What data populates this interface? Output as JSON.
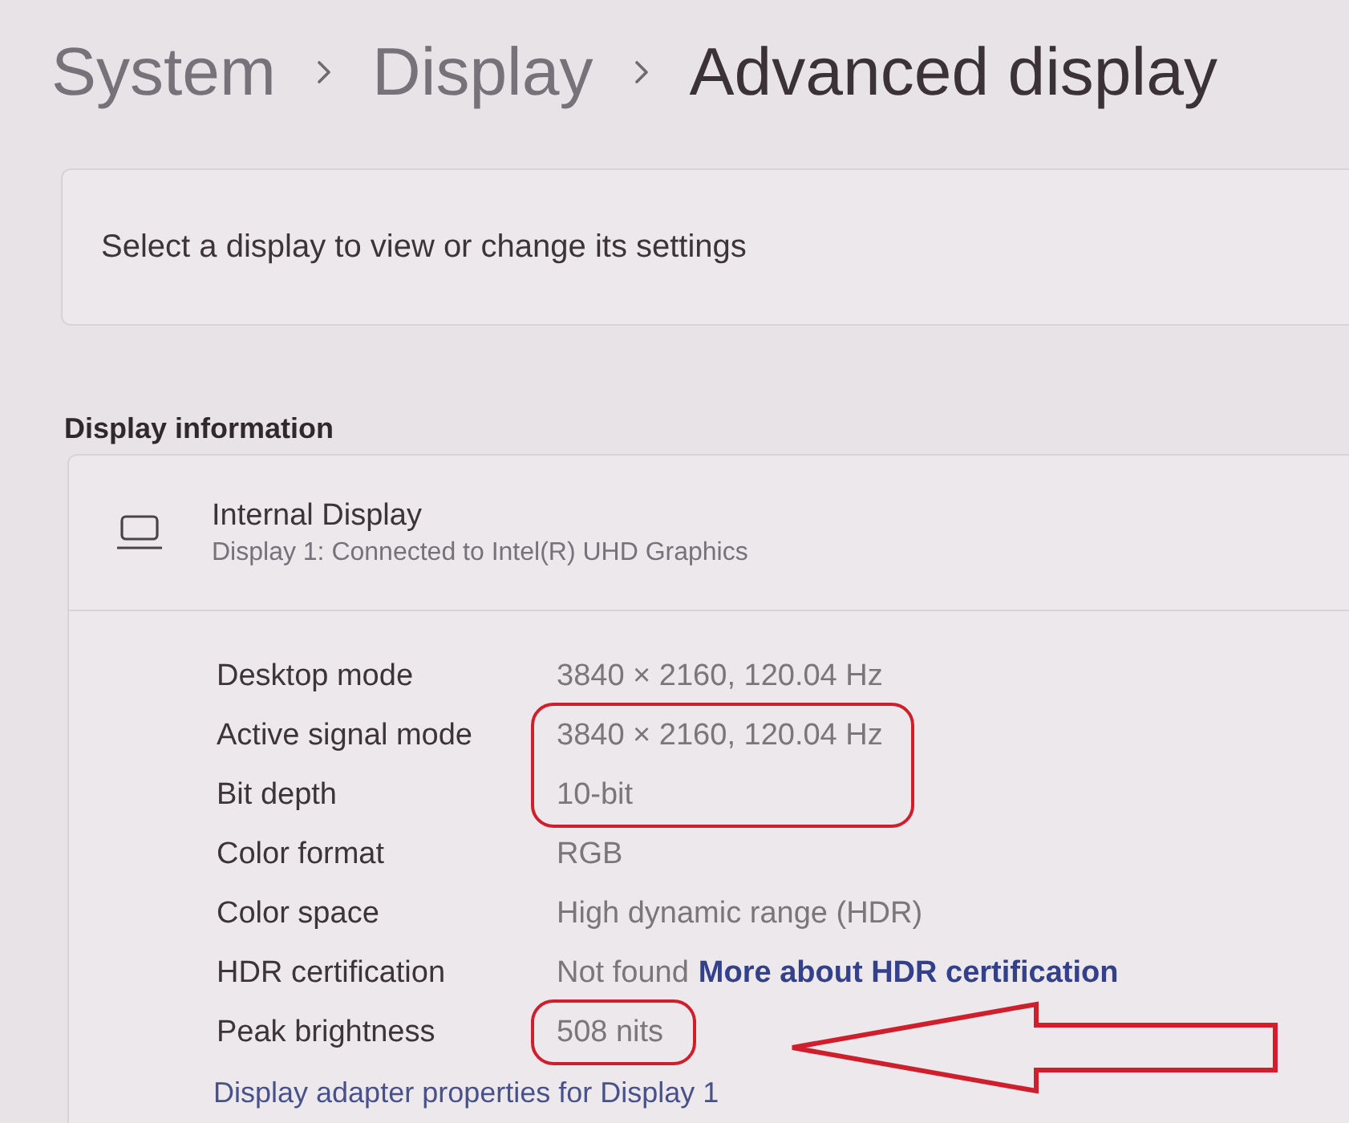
{
  "breadcrumb": [
    {
      "label": "System",
      "current": false
    },
    {
      "label": "Display",
      "current": false
    },
    {
      "label": "Advanced display",
      "current": true
    }
  ],
  "display_select": {
    "label": "Select a display to view or change its settings"
  },
  "section_title": "Display information",
  "display": {
    "name": "Internal Display",
    "description": "Display 1: Connected to Intel(R) UHD Graphics"
  },
  "info_rows": [
    {
      "label": "Desktop mode",
      "value": "3840 × 2160, 120.04 Hz",
      "circled": false,
      "arrow": false
    },
    {
      "label": "Active signal mode",
      "value": "3840 × 2160, 120.04 Hz",
      "circled": true,
      "arrow": false
    },
    {
      "label": "Bit depth",
      "value": "10-bit",
      "circled": true,
      "arrow": false
    },
    {
      "label": "Color format",
      "value": "RGB",
      "circled": false,
      "arrow": false
    },
    {
      "label": "Color space",
      "value": "High dynamic range (HDR)",
      "circled": false,
      "arrow": false
    },
    {
      "label": "HDR certification",
      "value": "Not found",
      "link": "More about HDR certification",
      "circled": false,
      "arrow": false
    },
    {
      "label": "Peak brightness",
      "value": "508 nits",
      "circled": true,
      "arrow": true
    }
  ],
  "adapter_link": "Display adapter properties for Display 1"
}
